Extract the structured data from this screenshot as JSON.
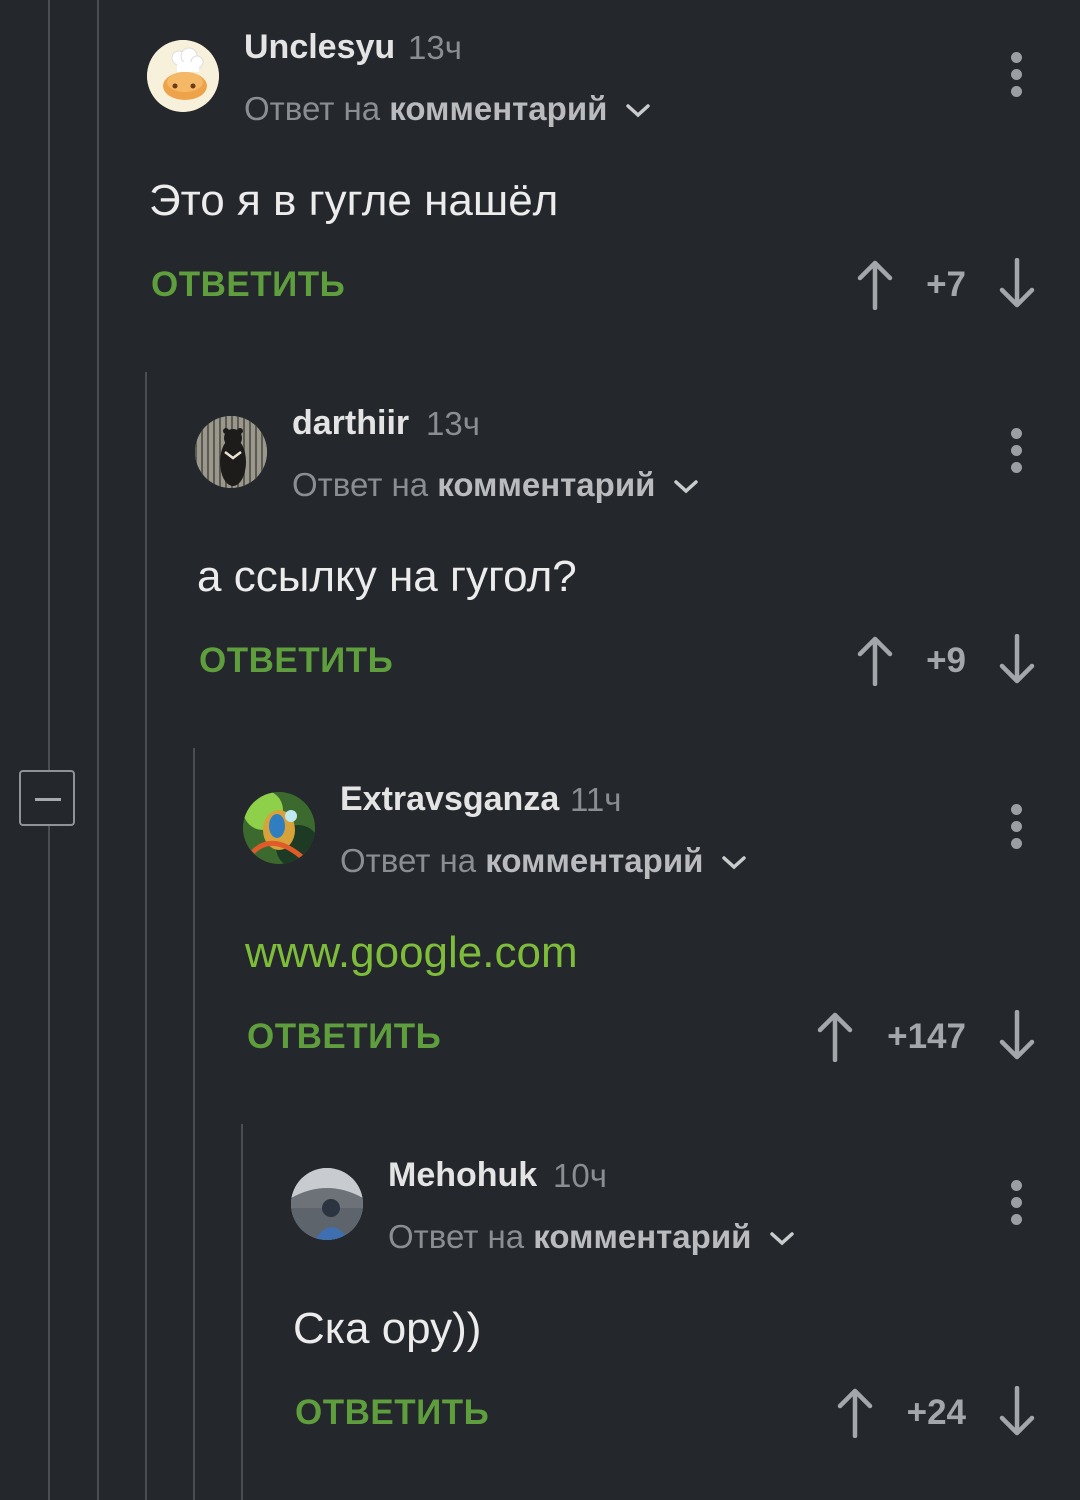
{
  "reply_prefix": "Ответ на",
  "reply_target": "комментарий",
  "reply_button": "ОТВЕТИТЬ",
  "colors": {
    "background": "#24272b",
    "accent_green": "#5e9e3c",
    "link_green": "#7dbd3a"
  },
  "comments": [
    {
      "username": "Unclesyu",
      "time": "13ч",
      "text": "Это я в гугле нашёл",
      "score": "+7",
      "avatar": "chef-bun-avatar"
    },
    {
      "username": "darthiir",
      "time": "13ч",
      "text": "а ссылку на гугол?",
      "score": "+9",
      "avatar": "bear-photo-avatar"
    },
    {
      "username": "Extravsganza",
      "time": "11ч",
      "text": "www.google.com",
      "score": "+147",
      "avatar": "colorful-animal-avatar"
    },
    {
      "username": "Mehohuk",
      "time": "10ч",
      "text": "Ска ору))",
      "score": "+24",
      "avatar": "person-photo-avatar"
    }
  ]
}
